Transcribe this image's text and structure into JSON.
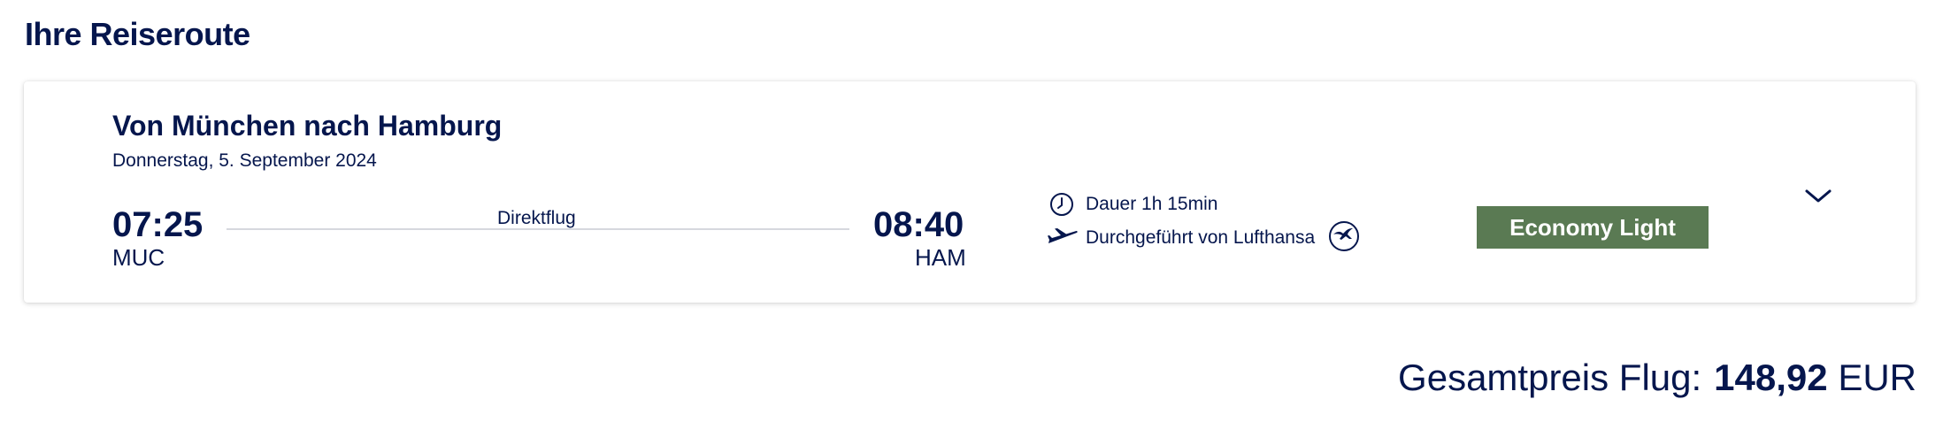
{
  "page": {
    "title": "Ihre Reiseroute"
  },
  "itinerary": {
    "route_title": "Von München nach Hamburg",
    "date": "Donnerstag, 5. September 2024",
    "departure": {
      "time": "07:25",
      "code": "MUC"
    },
    "arrival": {
      "time": "08:40",
      "code": "HAM"
    },
    "flight_type": "Direktflug",
    "duration": "Dauer 1h 15min",
    "operated_by": "Durchgeführt von Lufthansa",
    "fare_class": "Economy Light",
    "fare_color": "#5a7a53",
    "icons": {
      "duration": "clock-icon",
      "operator": "airplane-icon",
      "airline_logo": "lufthansa-crane-logo",
      "expand": "chevron-down-icon"
    }
  },
  "total": {
    "label": "Gesamtpreis Flug:",
    "amount": "148,92",
    "currency": "EUR"
  },
  "colors": {
    "primary_text": "#05164d",
    "divider": "#d6d8de"
  }
}
